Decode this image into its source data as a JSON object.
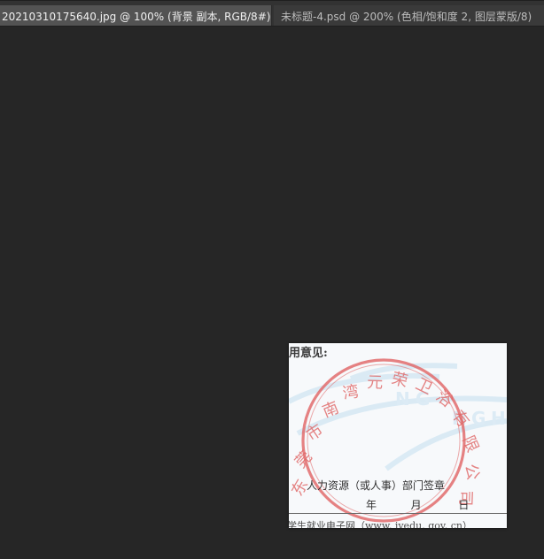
{
  "tabs": [
    {
      "label": "20210310175640.jpg @ 100% (背景 副本, RGB/8#) *",
      "close": "×",
      "active": true
    },
    {
      "label": "未标题-4.psd @ 200% (色相/饱和度 2, 图层蒙版/8)",
      "active": false
    }
  ],
  "document": {
    "heading": "用意见:",
    "hr_label": "人力资源（或人事）部门签章",
    "date": {
      "year": "年",
      "month": "月",
      "day": "日"
    },
    "footer": "学生就业电子网（www. jyedu. gov. cn）",
    "seal": {
      "text": "东莞市南湾元荣卫浴有限公司",
      "color": "#e06666"
    },
    "watermark_color": "#d7e9f4"
  },
  "colors": {
    "app_background": "#262626",
    "tabbar_background": "#323232",
    "active_tab": "#535353",
    "inactive_tab": "#3a3a3a"
  }
}
